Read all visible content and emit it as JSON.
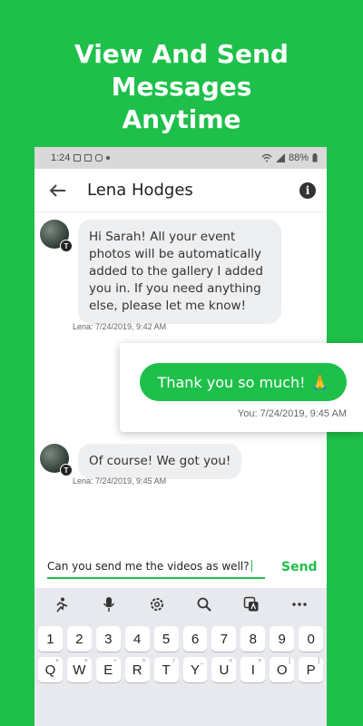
{
  "headline": [
    "View And Send",
    "Messages",
    "Anytime"
  ],
  "status": {
    "time": "1:24",
    "battery": "88%"
  },
  "header": {
    "contact_name": "Lena Hodges",
    "info_glyph": "i"
  },
  "messages": [
    {
      "sender": "Lena",
      "text": "Hi Sarah! All your event photos will be automatically added to the gallery I added you in. If you need anything else, please let me know!",
      "timestamp": "Lena: 7/24/2019, 9:42 AM"
    },
    {
      "sender": "You",
      "text": "Thank you so much!",
      "emoji": "🙏",
      "timestamp": "You: 7/24/2019, 9:45 AM"
    },
    {
      "sender": "Lena",
      "text": "Of course! We got you!",
      "timestamp": "Lena: 7/24/2019, 9:45 AM"
    }
  ],
  "avatar_badge": "T",
  "composer": {
    "value": "Can you send me the videos as well?",
    "send_label": "Send"
  },
  "keyboard": {
    "number_row": [
      "1",
      "2",
      "3",
      "4",
      "5",
      "6",
      "7",
      "8",
      "9",
      "0"
    ],
    "letter_row": [
      "Q",
      "W",
      "E",
      "R",
      "T",
      "Y",
      "U",
      "I",
      "O",
      "P"
    ],
    "letter_row_hints": [
      "+",
      "×",
      "÷",
      "=",
      "/",
      "_",
      "<",
      ">",
      "[",
      "]"
    ],
    "toolbar_icons": [
      "sticker-icon",
      "mic-icon",
      "settings-icon",
      "search-icon",
      "translate-icon",
      "more-icon"
    ]
  },
  "colors": {
    "brand_green": "#1ec04a",
    "bubble_gray": "#eeeff1"
  }
}
